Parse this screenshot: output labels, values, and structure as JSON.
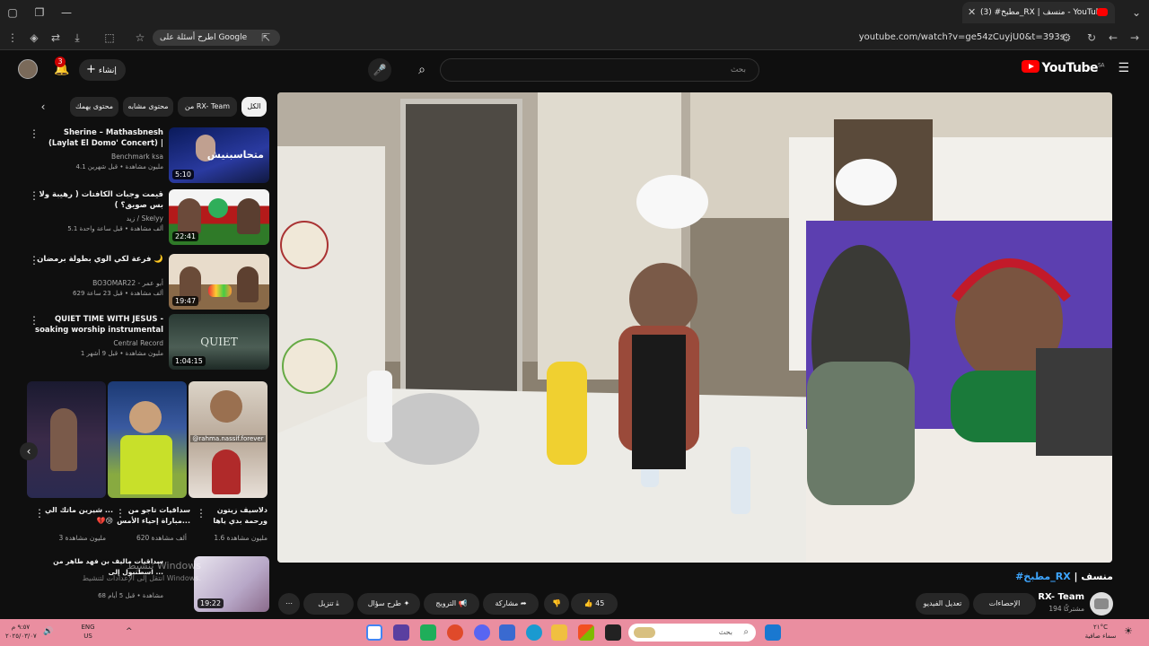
{
  "browser": {
    "tab_title": "(3) #مطبخ_RX | منسف - YouTube",
    "chip_label": "اطرح أسئلة على Google",
    "url": "youtube.com/watch?v=ge54zCuyjU0&t=393s"
  },
  "youtube": {
    "create_label": "إنشاء",
    "notification_count": "3",
    "search_placeholder": "بحث",
    "logo_text": "YouTube",
    "logo_region": "SA"
  },
  "sidebar": {
    "chips": [
      "الكل",
      "من RX- Team",
      "محتوى مشابه",
      "محتوى يهمك"
    ],
    "recommendations": [
      {
        "title": "Sherine – Mathasbnesh (Laylat El Domo' Concert) | شيرين – ...",
        "channel": "Benchmark ksa",
        "meta": "4.1 مليون مشاهدة • قبل شهرين",
        "duration": "5:10"
      },
      {
        "title": "قيمت وجبات الكافتات ( رهيبة ولا بس صويق؟ )",
        "channel": "زيد / Skelyy",
        "meta": "5.1 ألف مشاهدة • قبل ساعة واحدة",
        "duration": "22:41"
      },
      {
        "title": "فرعة لكي الوي بطولة برمضان 🌙",
        "channel": "BO3OMAR22 - أبو عمر",
        "meta": "629 ألف مشاهدة • قبل 23 ساعة",
        "duration": "19:47"
      },
      {
        "title": "QUIET TIME WITH JESUS - soaking worship instrumental | ...",
        "channel": "Central Record",
        "meta": "1 مليون مشاهدة • قبل 9 أشهر",
        "duration": "1:04:15"
      }
    ],
    "shorts": [
      {
        "title": "دلاسيف زيتون ورحمة بدي ياها",
        "views": "1.6 مليون مشاهدة",
        "handle": "@rahma.nassif.forever"
      },
      {
        "title": "سداقيات تاجو من مباراة إحياء الأمس...",
        "views": "620 ألف مشاهدة"
      },
      {
        "title": "شيرين ماتك الي ... 💔😢",
        "views": "3 مليون مشاهدة"
      }
    ],
    "last_rec": {
      "title": "سداقيات ماليف بن فهد طاهر من اسطنبول إلى ...",
      "meta": "68 مشاهدة • قبل 5 أيام",
      "duration": "19:22"
    }
  },
  "video": {
    "tag": "#مطبخ_RX",
    "title_rest": " | منسف",
    "channel": "RX- Team",
    "subs": "194 مشتركًا",
    "likes": "45",
    "actions": {
      "stats": "الإحصاءات",
      "edit": "تعديل الفيديو",
      "share": "مشاركة",
      "promote": "الترويج",
      "ask": "طرح سؤال",
      "download": "تنزيل"
    }
  },
  "windows": {
    "activate_line1": "تنشيط Windows",
    "activate_line2": "انتقل إلى الإعدادات لتنشيط Windows.",
    "search_placeholder": "بحث",
    "lang": "ENG",
    "region": "US",
    "time": "٩:٥٧ م",
    "date": "٢٠٢٥/٠٣/٠٧",
    "weather": "٢١°C",
    "weather_desc": "سماء صافية"
  }
}
